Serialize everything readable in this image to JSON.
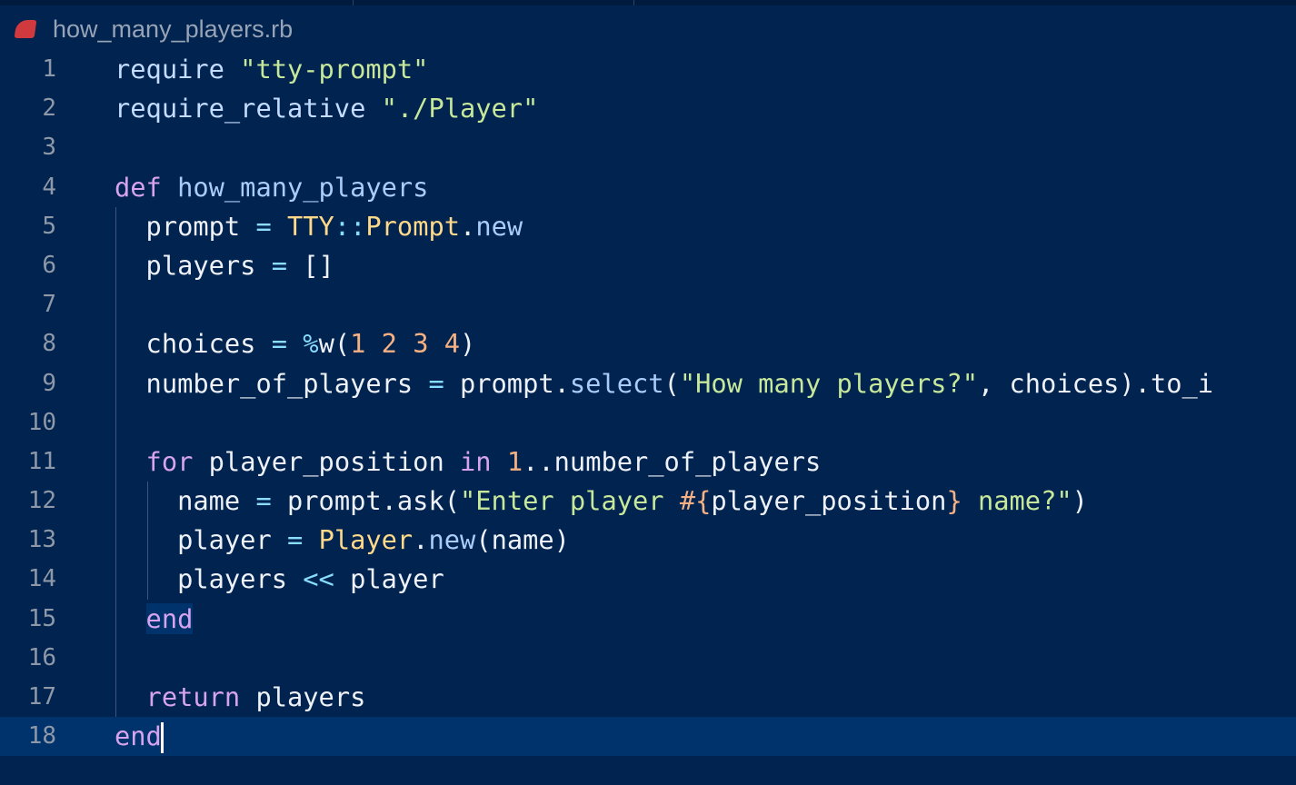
{
  "tab": {
    "filename": "how_many_players.rb",
    "icon": "ruby-file-icon"
  },
  "colors": {
    "background": "#00234f",
    "keyword": "#d7a3ef",
    "string": "#c7e89a",
    "operator": "#89ddff",
    "number": "#f5b183",
    "class": "#ffd98a",
    "method": "#a9cdfa"
  },
  "editor": {
    "current_line": 18,
    "lines": [
      {
        "n": "1",
        "indent": 0,
        "tokens": [
          [
            "require ",
            "req"
          ],
          [
            "\"tty-prompt\"",
            "str"
          ]
        ]
      },
      {
        "n": "2",
        "indent": 0,
        "tokens": [
          [
            "require_relative ",
            "req"
          ],
          [
            "\"./Player\"",
            "str"
          ]
        ]
      },
      {
        "n": "3",
        "indent": 0,
        "tokens": []
      },
      {
        "n": "4",
        "indent": 0,
        "tokens": [
          [
            "def ",
            "kw"
          ],
          [
            "how_many_players",
            "meth"
          ]
        ]
      },
      {
        "n": "5",
        "indent": 1,
        "tokens": [
          [
            "  prompt ",
            "id"
          ],
          [
            "=",
            "op"
          ],
          [
            " ",
            "id"
          ],
          [
            "TTY",
            "cls"
          ],
          [
            "::",
            "op"
          ],
          [
            "Prompt",
            "cls"
          ],
          [
            ".",
            "id"
          ],
          [
            "new",
            "meth"
          ]
        ]
      },
      {
        "n": "6",
        "indent": 1,
        "tokens": [
          [
            "  players ",
            "id"
          ],
          [
            "=",
            "op"
          ],
          [
            " []",
            "id"
          ]
        ]
      },
      {
        "n": "7",
        "indent": 1,
        "tokens": []
      },
      {
        "n": "8",
        "indent": 1,
        "tokens": [
          [
            "  choices ",
            "id"
          ],
          [
            "=",
            "op"
          ],
          [
            " ",
            "id"
          ],
          [
            "%",
            "op"
          ],
          [
            "w(",
            "id"
          ],
          [
            "1 2 3 4",
            "num"
          ],
          [
            ")",
            "id"
          ]
        ]
      },
      {
        "n": "9",
        "indent": 1,
        "tokens": [
          [
            "  number_of_players ",
            "id"
          ],
          [
            "=",
            "op"
          ],
          [
            " prompt.",
            "id"
          ],
          [
            "select",
            "meth"
          ],
          [
            "(",
            "id"
          ],
          [
            "\"How many players?\"",
            "str"
          ],
          [
            ", choices).to_i",
            "id"
          ]
        ]
      },
      {
        "n": "10",
        "indent": 1,
        "tokens": []
      },
      {
        "n": "11",
        "indent": 1,
        "tokens": [
          [
            "  ",
            "id"
          ],
          [
            "for",
            "kw"
          ],
          [
            " player_position ",
            "id"
          ],
          [
            "in",
            "kw"
          ],
          [
            " ",
            "id"
          ],
          [
            "1",
            "num"
          ],
          [
            "..number_of_players",
            "id"
          ]
        ]
      },
      {
        "n": "12",
        "indent": 2,
        "tokens": [
          [
            "    name ",
            "id"
          ],
          [
            "=",
            "op"
          ],
          [
            " prompt.ask(",
            "id"
          ],
          [
            "\"Enter player ",
            "str"
          ],
          [
            "#{",
            "interp"
          ],
          [
            "player_position",
            "id"
          ],
          [
            "}",
            "interp"
          ],
          [
            " name?\"",
            "str"
          ],
          [
            ")",
            "id"
          ]
        ]
      },
      {
        "n": "13",
        "indent": 2,
        "tokens": [
          [
            "    player ",
            "id"
          ],
          [
            "=",
            "op"
          ],
          [
            " ",
            "id"
          ],
          [
            "Player",
            "cls"
          ],
          [
            ".",
            "id"
          ],
          [
            "new",
            "meth"
          ],
          [
            "(name)",
            "id"
          ]
        ]
      },
      {
        "n": "14",
        "indent": 2,
        "tokens": [
          [
            "    players ",
            "id"
          ],
          [
            "<<",
            "op"
          ],
          [
            " player",
            "id"
          ]
        ]
      },
      {
        "n": "15",
        "indent": 1,
        "tokens": [
          [
            "  ",
            "id"
          ],
          [
            "end",
            "kw match"
          ]
        ]
      },
      {
        "n": "16",
        "indent": 1,
        "tokens": []
      },
      {
        "n": "17",
        "indent": 1,
        "tokens": [
          [
            "  ",
            "id"
          ],
          [
            "return",
            "kw"
          ],
          [
            " players",
            "id"
          ]
        ]
      },
      {
        "n": "18",
        "indent": 0,
        "tokens": [
          [
            "end",
            "kw"
          ]
        ]
      }
    ]
  }
}
